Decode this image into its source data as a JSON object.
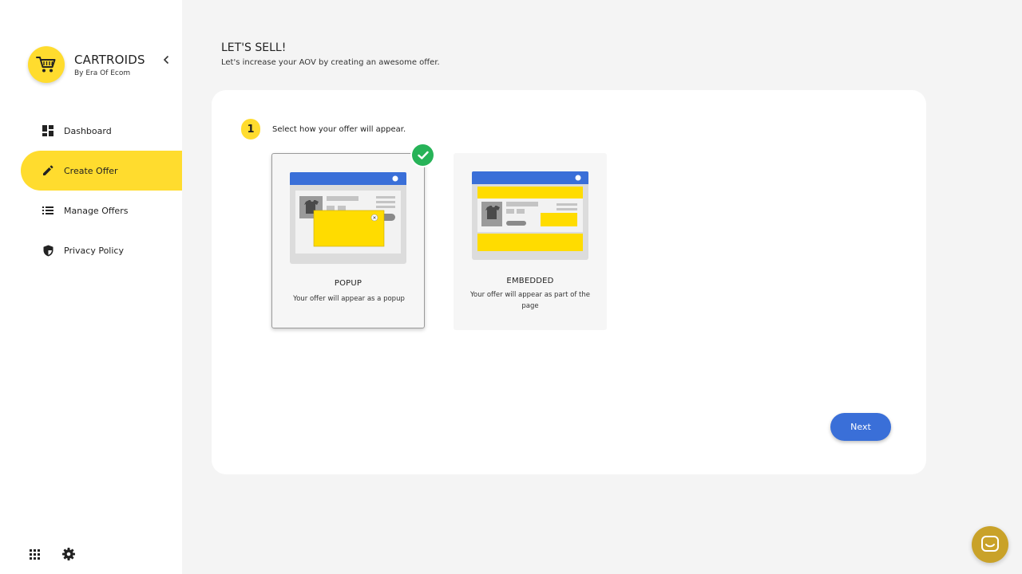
{
  "brand": {
    "name": "CARTROIDS",
    "subtitle": "By Era Of Ecom"
  },
  "nav": {
    "items": [
      {
        "label": "Dashboard",
        "icon": "dashboard-icon",
        "active": false
      },
      {
        "label": "Create Offer",
        "icon": "pencil-icon",
        "active": true
      },
      {
        "label": "Manage Offers",
        "icon": "list-icon",
        "active": false
      },
      {
        "label": "Privacy Policy",
        "icon": "shield-icon",
        "active": false
      }
    ]
  },
  "header": {
    "title": "LET'S SELL!",
    "subtitle": "Let's increase your AOV by creating an awesome offer."
  },
  "step": {
    "number": "1",
    "label": "Select how your offer will appear."
  },
  "options": [
    {
      "title": "POPUP",
      "description": "Your offer will appear as a popup",
      "selected": true
    },
    {
      "title": "EMBEDDED",
      "description": "Your offer will appear as part of the page",
      "selected": false
    }
  ],
  "actions": {
    "next_label": "Next"
  },
  "colors": {
    "accent": "#ffdc2e",
    "primary": "#3a6fd8",
    "success": "#27b358",
    "chat": "#c9a229"
  }
}
